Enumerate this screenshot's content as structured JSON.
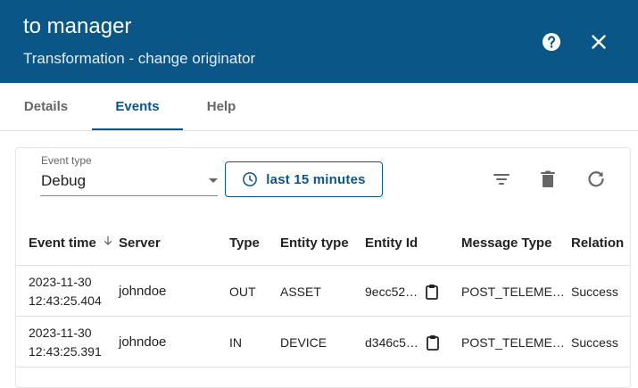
{
  "header": {
    "title": "to manager",
    "subtitle": "Transformation - change originator",
    "help_icon": "help-circle-icon",
    "close_icon": "close-icon"
  },
  "tabs": [
    {
      "label": "Details",
      "active": false
    },
    {
      "label": "Events",
      "active": true
    },
    {
      "label": "Help",
      "active": false
    }
  ],
  "toolbar": {
    "event_type_label": "Event type",
    "event_type_value": "Debug",
    "time_button_label": "last 15 minutes",
    "icons": [
      "clock-icon",
      "filter-icon",
      "delete-icon",
      "refresh-icon"
    ]
  },
  "table": {
    "columns": [
      "Event time",
      "Server",
      "Type",
      "Entity type",
      "Entity Id",
      "Message Type",
      "Relation"
    ],
    "rows": [
      {
        "date": "2023-11-30",
        "time": "12:43:25.404",
        "server": "johndoe",
        "type": "OUT",
        "entity_type": "ASSET",
        "entity_id": "9ecc52…",
        "message_type": "POST_TELEME…",
        "relation": "Success"
      },
      {
        "date": "2023-11-30",
        "time": "12:43:25.391",
        "server": "johndoe",
        "type": "IN",
        "entity_type": "DEVICE",
        "entity_id": "d346c5…",
        "message_type": "POST_TELEME…",
        "relation": "Success"
      }
    ]
  },
  "colors": {
    "primary": "#0a5686",
    "header_text": "#ffffff",
    "tab_inactive": "#666666"
  }
}
